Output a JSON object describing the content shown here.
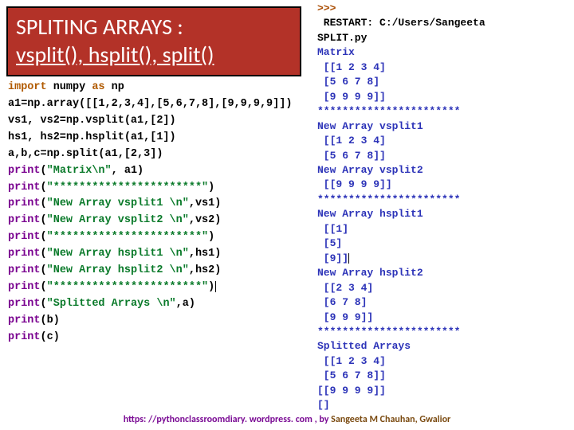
{
  "title": {
    "line1": "SPLITING ARRAYS :",
    "line2": "vsplit(), hsplit(), split()"
  },
  "code": {
    "l1p1": "import",
    "l1p2": " numpy ",
    "l1p3": "as",
    "l1p4": " np",
    "l2": "a1=np.array([[1,2,3,4],[5,6,7,8],[9,9,9,9]])",
    "l3": "vs1, vs2=np.vsplit(a1,[2])",
    "l4": "hs1, hs2=np.hsplit(a1,[1])",
    "l5": "a,b,c=np.split(a1,[2,3])",
    "p": "print",
    "l6a": "(",
    "l6b": "\"Matrix\\n\"",
    "l6c": ", a1)",
    "l7a": "(",
    "l7b": "\"***********************\"",
    "l7c": ")",
    "l8a": "(",
    "l8b": "\"New Array vsplit1 \\n\"",
    "l8c": ",vs1)",
    "l9a": "(",
    "l9b": "\"New Array vsplit2 \\n\"",
    "l9c": ",vs2)",
    "l10a": "(",
    "l10b": "\"***********************\"",
    "l10c": ")",
    "l11a": "(",
    "l11b": "\"New Array hsplit1 \\n\"",
    "l11c": ",hs1)",
    "l12a": "(",
    "l12b": "\"New Array hsplit2 \\n\"",
    "l12c": ",hs2)",
    "l13a": "(",
    "l13b": "\"***********************\"",
    "l13c": ")",
    "l14a": "(",
    "l14b": "\"Splitted Arrays \\n\"",
    "l14c": ",a)",
    "l15": "(b)",
    "l16": "(c)"
  },
  "output": {
    "o1": ">>>",
    "o2": " RESTART: C:/Users/Sangeeta",
    "o3": "SPLIT.py",
    "o4": "Matrix",
    "o5": " [[1 2 3 4]",
    "o6": " [5 6 7 8]",
    "o7": " [9 9 9 9]]",
    "o8": "***********************",
    "o9": "New Array vsplit1",
    "o10": " [[1 2 3 4]",
    "o11": " [5 6 7 8]]",
    "o12": "New Array vsplit2",
    "o13": " [[9 9 9 9]]",
    "o14": "***********************",
    "o15": "New Array hsplit1",
    "o16": " [[1]",
    "o17": " [5]",
    "o18": " [9]]",
    "o19": "New Array hsplit2",
    "o20": " [[2 3 4]",
    "o21": " [6 7 8]",
    "o22": " [9 9 9]]",
    "o23": "***********************",
    "o24": "Splitted Arrays",
    "o25": " [[1 2 3 4]",
    "o26": " [5 6 7 8]]",
    "o27": "[[9 9 9 9]]",
    "o28": "[]"
  },
  "footer": {
    "link": "https: //pythonclassroomdiary. wordpress. com , by",
    "author": "  Sangeeta M Chauhan, Gwalior"
  }
}
